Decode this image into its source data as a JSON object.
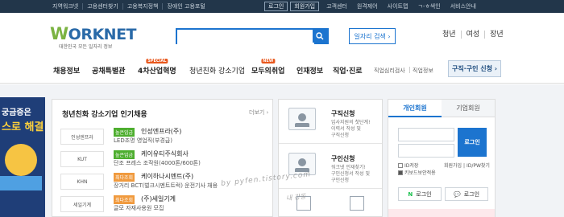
{
  "topbar": {
    "links": [
      "지역워크넷",
      "고용센터찾기",
      "고용복지정책",
      "장애인 고용포털"
    ],
    "login": "로그인",
    "join": "회원가입",
    "customer_center": "고객센터",
    "remote": "원격제어",
    "sitemap": "사이트맵",
    "font_size": "ㄱ-ㅎ색인",
    "service_guide": "서비스안내"
  },
  "logo": {
    "brand_w": "W",
    "brand_rest": "ORKNET",
    "tagline": "대한민국 모든 일자리 정보"
  },
  "search": {
    "placeholder": "",
    "job_search_label": "일자리 검색 ›"
  },
  "audience": [
    "청년",
    "여성",
    "장년"
  ],
  "gnb": {
    "items": [
      "채용정보",
      "공채특별관",
      "4차산업혁명",
      "청년친화 강소기업",
      "모두의취업",
      "인재정보",
      "직업·진로"
    ],
    "badges": {
      "special": "SPECIAL",
      "new": "NEW"
    },
    "small_items": [
      "직업심리검사",
      "직업정보"
    ],
    "cta": "구직·구인 신청 ›"
  },
  "banner": {
    "line1": "궁금증은",
    "line2": "스로 해결"
  },
  "featured": {
    "title": "청년친화 강소기업 인기채용",
    "more": "더보기 ›",
    "rows": [
      {
        "logo": "인성엔프라",
        "tag": "높은임금",
        "company": "인성엔프라(주)",
        "desc": "LED조명 영업직(부경급)"
      },
      {
        "logo": "KUT",
        "tag": "높은임금",
        "company": "케이유티주식회사",
        "desc": "단조 프레스 조작원(4000톤/600톤)"
      },
      {
        "logo": "KHN",
        "tag": "최다조회",
        "company": "케이하나시멘트(주)",
        "desc": "장거리 BCT(벌크시멘트트럭) 운전기사 채용"
      },
      {
        "logo": "세일기계",
        "tag": "최다조회",
        "company": "(주)세일기계",
        "desc": "글모 자재사용원 모집"
      }
    ]
  },
  "services": {
    "apply_job": {
      "name": "구직신청",
      "lines": [
        "입사지원의 첫단계!",
        "이력서 작성 및",
        "구직신청"
      ]
    },
    "apply_hire": {
      "name": "구인신청",
      "lines": [
        "워크넷 인재찾기!",
        "구인신청서 작성 및",
        "구인신청"
      ]
    }
  },
  "login": {
    "tab_personal": "개인회원",
    "tab_company": "기업회원",
    "id_placeholder": "",
    "pw_placeholder": "",
    "login_button": "로그인",
    "save_id": "ID저장",
    "keyboard_security": "키보드보안적용",
    "join": "회원가입",
    "find": "ID/PW찾기",
    "naver_login": "로그인",
    "kakao_login": "로그인",
    "naver_mark": "N",
    "kakao_mark": "💬"
  },
  "watermark": {
    "line1": "by pyfen.tistory.com",
    "line2": "내 강동"
  }
}
